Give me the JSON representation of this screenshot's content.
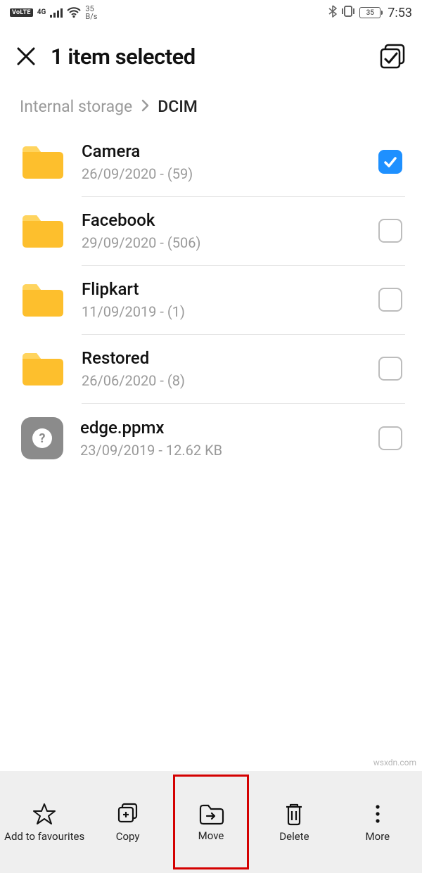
{
  "status": {
    "volte": "VoLTE",
    "net": "4G",
    "speed_top": "35",
    "speed_bottom": "B/s",
    "battery": "35",
    "time": "7:53"
  },
  "header": {
    "title": "1 item selected"
  },
  "breadcrumb": {
    "root": "Internal storage",
    "current": "DCIM"
  },
  "items": [
    {
      "name": "Camera",
      "meta": "26/09/2020 - (59)",
      "type": "folder",
      "selected": true
    },
    {
      "name": "Facebook",
      "meta": "29/09/2020 - (506)",
      "type": "folder",
      "selected": false
    },
    {
      "name": "Flipkart",
      "meta": "11/09/2019 - (1)",
      "type": "folder",
      "selected": false
    },
    {
      "name": "Restored",
      "meta": "26/06/2020 - (8)",
      "type": "folder",
      "selected": false
    },
    {
      "name": "edge.ppmx",
      "meta": "23/09/2019 - 12.62 KB",
      "type": "file",
      "selected": false
    }
  ],
  "actions": {
    "fav": "Add to favourites",
    "copy": "Copy",
    "move": "Move",
    "delete": "Delete",
    "more": "More"
  },
  "watermark": "wsxdn.com"
}
